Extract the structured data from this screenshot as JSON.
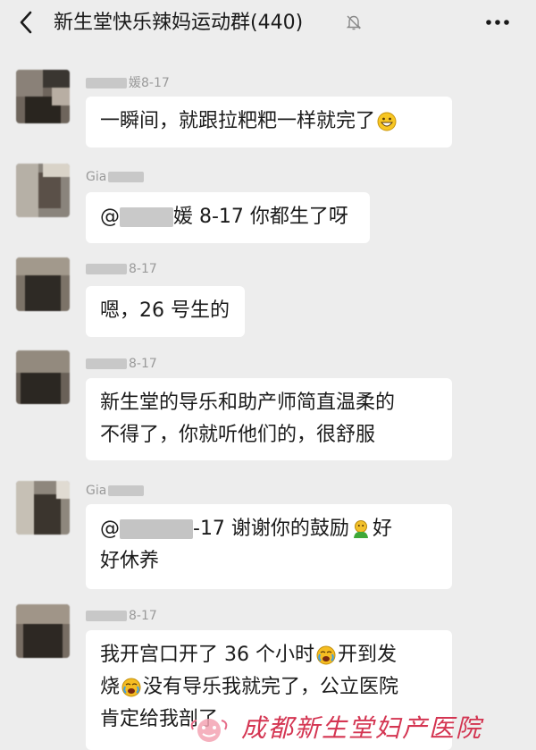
{
  "header": {
    "title": "新生堂快乐辣妈运动群(440)",
    "back_icon": "chevron-left-icon",
    "mute_icon": "bell-off-icon",
    "more_icon": "more-dots-icon"
  },
  "messages": [
    {
      "sender": "媛8-17",
      "text": "一瞬间，就跟拉粑粑一样就完了",
      "emoji": "grinning-face"
    },
    {
      "sender": "Gia",
      "text_before": "@",
      "text_after": "媛 8-17  你都生了呀"
    },
    {
      "sender": "8-17",
      "text": "嗯，26 号生的"
    },
    {
      "sender": "8-17",
      "line1": "新生堂的导乐和助产师简直温柔的",
      "line2": "不得了，你就听他们的，很舒服"
    },
    {
      "sender": "Gia",
      "l1_a": "@",
      "l1_b": "-17  谢谢你的鼓励",
      "l1_c": "好",
      "line2": "好休养",
      "emoji": "green-figure"
    },
    {
      "sender": "8-17",
      "l1_a": "我开宫口开了 36 个小时",
      "l1_b": "开到发",
      "l2_a": "烧",
      "l2_b": "没有导乐我就完了，公立医院",
      "line3": "肯定给我剖了",
      "emoji": "crying-face"
    }
  ],
  "watermark": {
    "text": "成都新生堂妇产医院",
    "logo": "hospital-logo"
  },
  "colors": {
    "background": "#ededed",
    "bubble": "#ffffff",
    "watermark": "#d02040"
  }
}
